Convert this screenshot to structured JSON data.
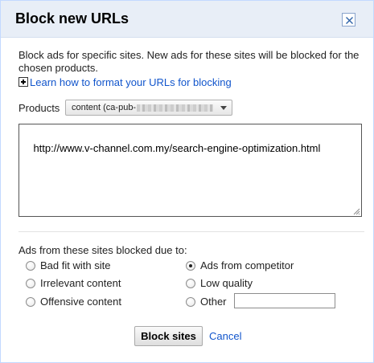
{
  "dialog": {
    "title": "Block new URLs",
    "close_icon": "close-icon",
    "description": "Block ads for specific sites. New ads for these sites will be blocked for the chosen products.",
    "learn_icon": "plus-box-icon",
    "learn_link": "Learn how to format your URLs for blocking"
  },
  "products": {
    "label": "Products",
    "selected_prefix": "content (ca-pub-"
  },
  "urls": {
    "value": "http://www.v-channel.com.my/search-engine-optimization.html"
  },
  "reasons": {
    "label": "Ads from these sites blocked due to:",
    "options": [
      {
        "label": "Bad fit with site",
        "checked": false
      },
      {
        "label": "Ads from competitor",
        "checked": true
      },
      {
        "label": "Irrelevant content",
        "checked": false
      },
      {
        "label": "Low quality",
        "checked": false
      },
      {
        "label": "Offensive content",
        "checked": false
      },
      {
        "label": "Other",
        "checked": false
      }
    ],
    "other_value": ""
  },
  "actions": {
    "block_label": "Block sites",
    "cancel_label": "Cancel"
  },
  "colors": {
    "header_bg": "#e8eef7",
    "border": "#c3d9ff",
    "link": "#1155cc"
  }
}
